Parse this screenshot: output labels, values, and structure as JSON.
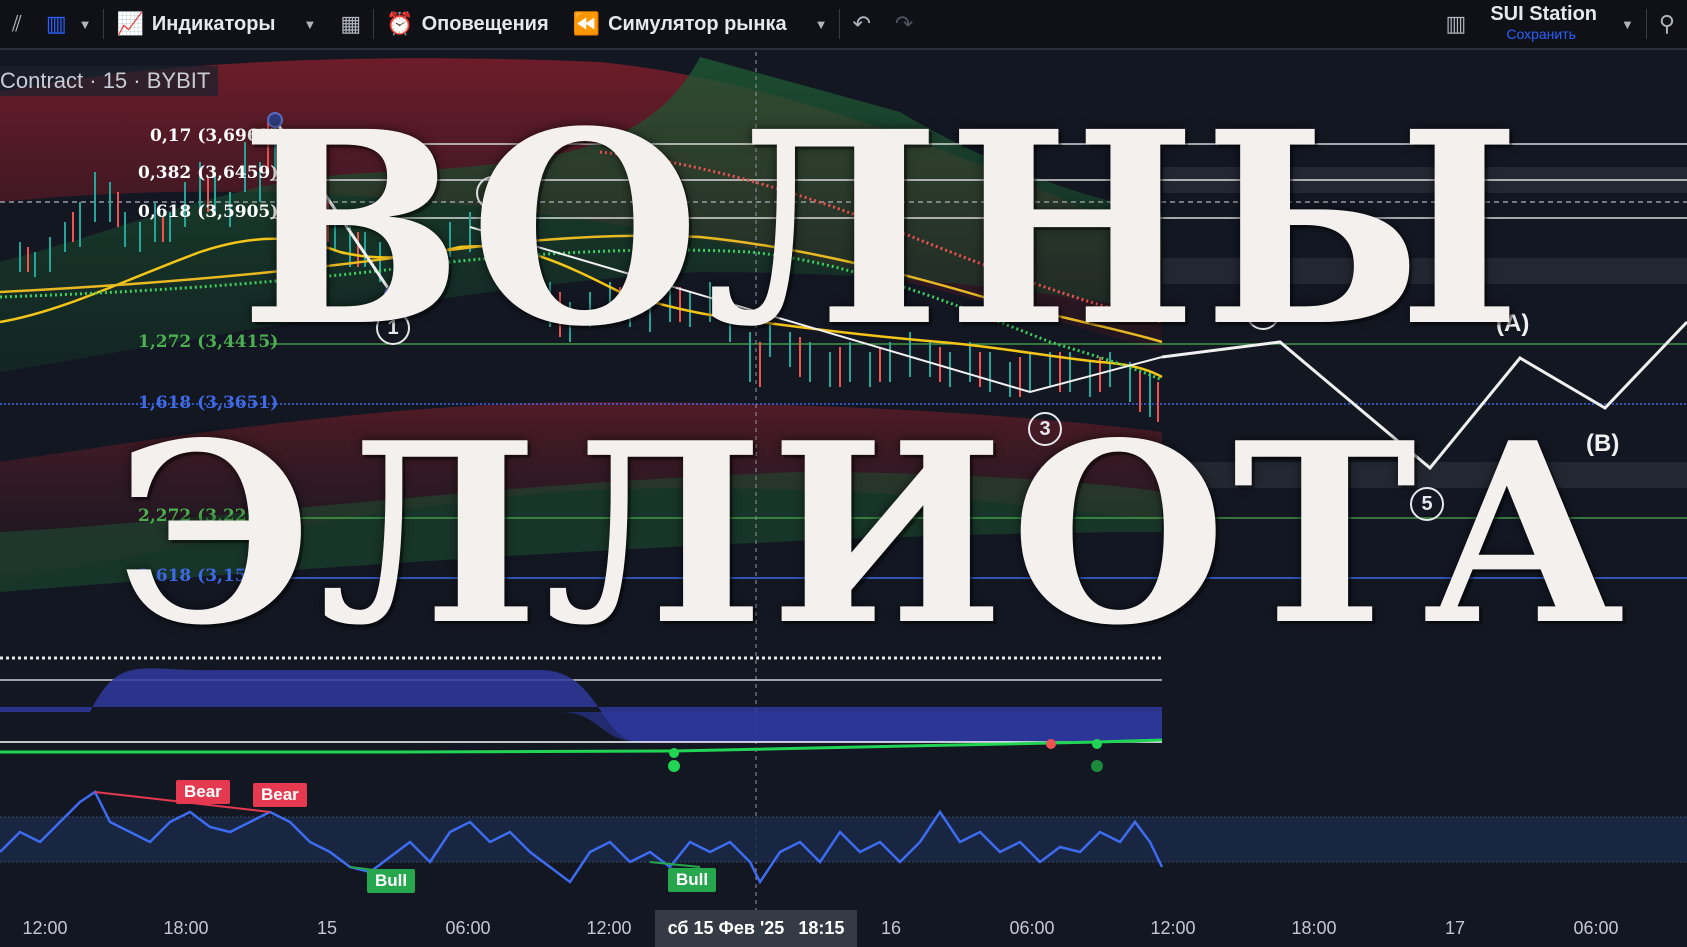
{
  "toolbar": {
    "indicators_label": "Индикаторы",
    "alerts_label": "Оповещения",
    "simulator_label": "Симулятор рынка",
    "station_name": "SUI Station",
    "station_save": "Сохранить",
    "icons": [
      "bar-type-icon",
      "candle-type-icon",
      "indicators-icon",
      "templates-icon",
      "alarm-clock-icon",
      "rewind-icon",
      "undo-icon",
      "redo-icon",
      "layout-icon",
      "quick-search-icon"
    ]
  },
  "chart": {
    "legend": "Contract · 15 · BYBIT",
    "fib_levels": [
      {
        "label": "0,17 (3,6963)",
        "color": "#ffffff"
      },
      {
        "label": "0,382 (3,6459)",
        "color": "#ffffff"
      },
      {
        "label": "0,618 (3,5905)",
        "color": "#ffffff"
      },
      {
        "label": "1,272 (3,4415)",
        "color": "#4caf50"
      },
      {
        "label": "1,618 (3,3651)",
        "color": "#3f6ae8"
      },
      {
        "label": "2,272 (3,2254)",
        "color": "#4caf50"
      },
      {
        "label": "2,618 (3,1539)",
        "color": "#3f6ae8"
      }
    ],
    "wave_labels": {
      "w1": "1",
      "w2": "2",
      "w3": "3",
      "w4": "4",
      "w5": "5",
      "wa": "(A)",
      "wb": "(B)"
    },
    "title_line1": "ВОЛНЫ",
    "title_line2": "ЭЛЛИОТА",
    "signals": {
      "bear1": "Bear",
      "bear2": "Bear",
      "bull1": "Bull",
      "bull2": "Bull"
    },
    "colors": {
      "background": "#131722",
      "bull": "#26a64d",
      "bear": "#e53950",
      "accent": "#2962ff",
      "ma_yellow": "#f5c518"
    }
  },
  "xaxis": {
    "labels": [
      "12:00",
      "18:00",
      "15",
      "06:00",
      "12:00",
      "16",
      "06:00",
      "12:00",
      "18:00",
      "17",
      "06:00"
    ],
    "crosshair_date": "сб 15 Фев '25",
    "crosshair_time": "18:15"
  }
}
